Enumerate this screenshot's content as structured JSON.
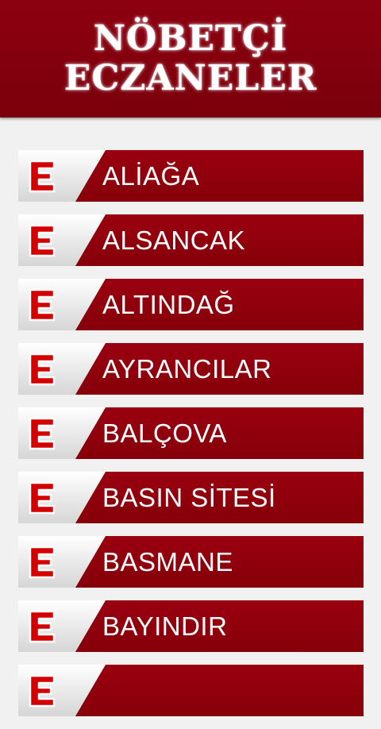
{
  "header": {
    "line1": "NÖBETÇİ",
    "line2": "ECZANELER"
  },
  "colors": {
    "brand_red": "#8a000c",
    "background": "#f1f1f1",
    "icon_red": "#d40000"
  },
  "icon": "pharmacy-e-icon",
  "districts": [
    "ALİAĞA",
    "ALSANCAK",
    "ALTINDAĞ",
    "AYRANCILAR",
    "BALÇOVA",
    "BASIN SİTESİ",
    "BASMANE",
    "BAYINDIR",
    ""
  ]
}
